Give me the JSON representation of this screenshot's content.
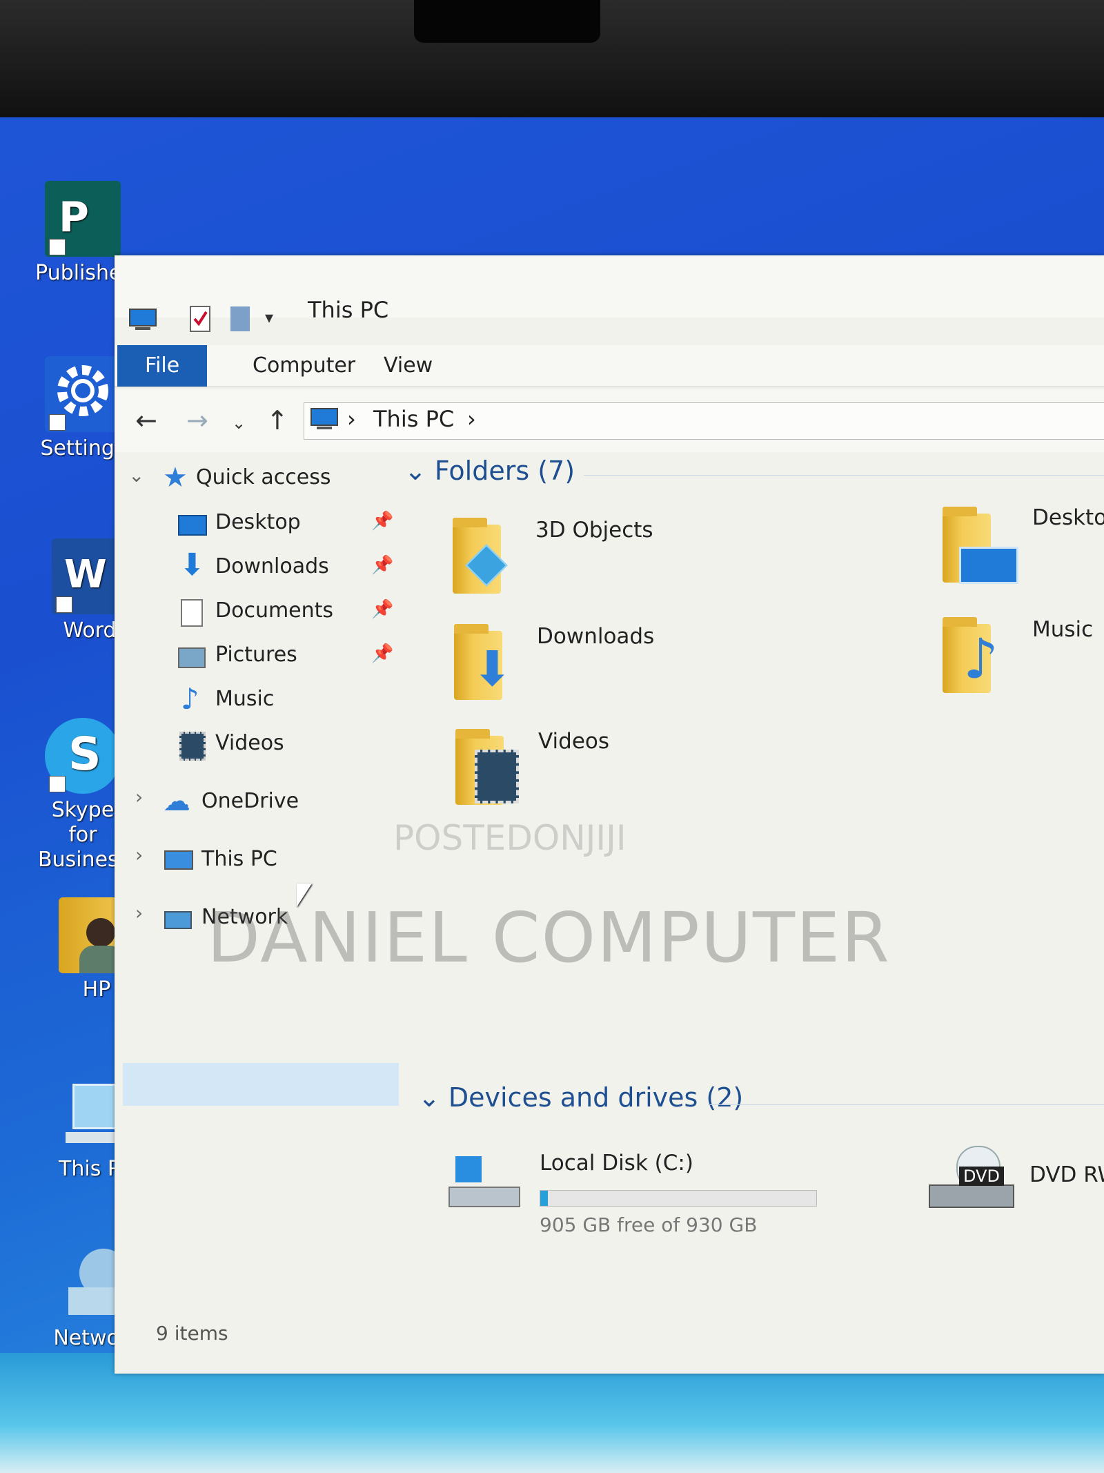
{
  "desktop": {
    "icons": [
      {
        "label": "Publisher"
      },
      {
        "label": "Settings"
      },
      {
        "label": "Word"
      },
      {
        "label": "Skype for Business"
      },
      {
        "label": "HP"
      },
      {
        "label": "This PC"
      },
      {
        "label": "Network"
      }
    ]
  },
  "explorer": {
    "title": "This PC",
    "ribbon": {
      "file": "File",
      "computer": "Computer",
      "view": "View"
    },
    "address": {
      "crumb": "This PC",
      "sep": "›"
    },
    "nav": {
      "quick_access": "Quick access",
      "items": [
        {
          "label": "Desktop",
          "pin": "📌"
        },
        {
          "label": "Downloads",
          "pin": "📌"
        },
        {
          "label": "Documents",
          "pin": "📌"
        },
        {
          "label": "Pictures",
          "pin": "📌"
        },
        {
          "label": "Music"
        },
        {
          "label": "Videos"
        }
      ],
      "onedrive": "OneDrive",
      "this_pc": "This PC",
      "network": "Network"
    },
    "folders_header": "Folders (7)",
    "folders": [
      {
        "label": "3D Objects"
      },
      {
        "label": "Desktop"
      },
      {
        "label": "Downloads"
      },
      {
        "label": "Music"
      },
      {
        "label": "Videos"
      }
    ],
    "devices_header": "Devices and drives (2)",
    "drives": {
      "local_name": "Local Disk (C:)",
      "local_space": "905 GB free of 930 GB",
      "local_fill": 0.027,
      "dvd_name": "DVD RW",
      "dvd_badge": "DVD"
    },
    "status": "9 items"
  },
  "watermark": {
    "main": "DANIEL COMPUTER",
    "top": "POSTEDONJIJI"
  }
}
